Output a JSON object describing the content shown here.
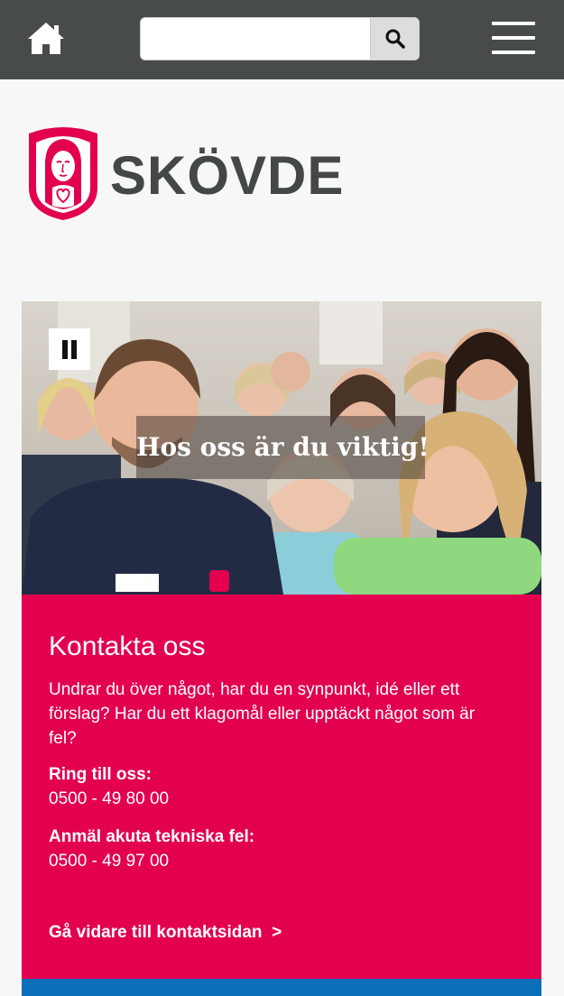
{
  "header": {
    "home_icon": "home-icon",
    "search": {
      "placeholder": "",
      "value": "",
      "button_icon": "search-icon"
    },
    "menu_icon": "hamburger-menu-icon",
    "bg_color": "#474c48"
  },
  "logo": {
    "name": "SKÖVDE",
    "emblem_color": "#e2004f",
    "text_color": "#434844"
  },
  "hero": {
    "caption": "Hos oss är du viktig!",
    "pause_icon": "pause-icon"
  },
  "contact": {
    "title": "Kontakta oss",
    "intro": "Undrar du över något, har du en synpunkt, idé eller ett förslag? Har du ett klagomål eller upptäckt något som är fel?",
    "phone_label": "Ring till oss:",
    "phone": "0500 - 49 80 00",
    "tech_label": "Anmäl akuta tekniska fel:",
    "tech_phone": "0500 - 49 97 00",
    "more_link": "Gå vidare till kontaktsidan  >",
    "bg_color": "#e2004f"
  },
  "colors": {
    "accent": "#e2004f",
    "blue": "#0a6fb8"
  }
}
